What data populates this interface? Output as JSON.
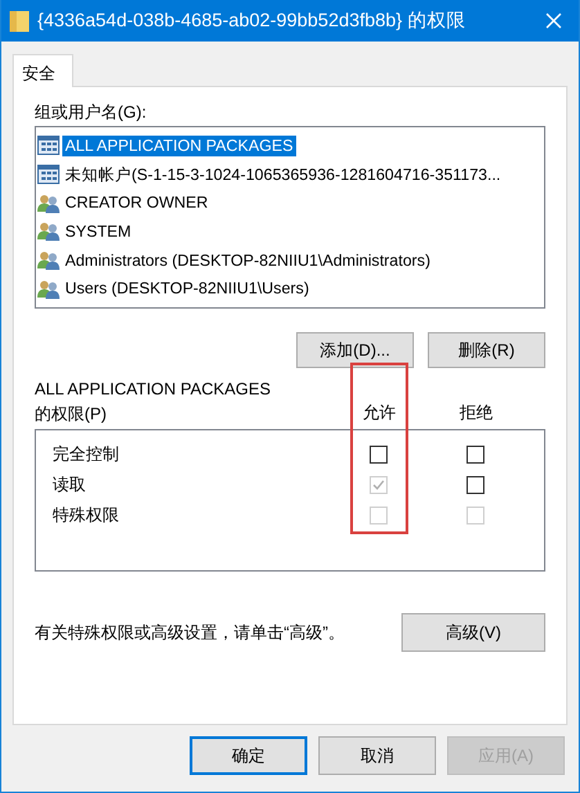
{
  "window": {
    "title": "{4336a54d-038b-4685-ab02-99bb52d3fb8b} 的权限"
  },
  "tabs": [
    {
      "label": "安全",
      "selected": true
    }
  ],
  "principals_label": "组或用户名(G):",
  "principals": [
    {
      "kind": "package",
      "name": "ALL APPLICATION PACKAGES",
      "selected": true
    },
    {
      "kind": "package",
      "name": "未知帐户(S-1-15-3-1024-1065365936-1281604716-351173...",
      "selected": false
    },
    {
      "kind": "group",
      "name": "CREATOR OWNER",
      "selected": false
    },
    {
      "kind": "group",
      "name": "SYSTEM",
      "selected": false
    },
    {
      "kind": "group",
      "name": "Administrators (DESKTOP-82NIIU1\\Administrators)",
      "selected": false
    },
    {
      "kind": "group",
      "name": "Users (DESKTOP-82NIIU1\\Users)",
      "selected": false
    }
  ],
  "principal_buttons": [
    "添加(D)...",
    "删除(R)"
  ],
  "permissions": {
    "title": "ALL APPLICATION PACKAGES\n的权限(P)",
    "columns": [
      {
        "label": "允许",
        "highlighted": true
      },
      {
        "label": "拒绝",
        "highlighted": false
      }
    ],
    "rows": [
      {
        "label": "完全控制",
        "cells": [
          {
            "checked": false,
            "disabled": false
          },
          {
            "checked": false,
            "disabled": false
          }
        ]
      },
      {
        "label": "读取",
        "cells": [
          {
            "checked": true,
            "disabled": true
          },
          {
            "checked": false,
            "disabled": false
          }
        ]
      },
      {
        "label": "特殊权限",
        "cells": [
          {
            "checked": false,
            "disabled": true
          },
          {
            "checked": false,
            "disabled": true
          }
        ]
      }
    ]
  },
  "advanced_hint": "有关特殊权限或高级设置，请单击“高级”。",
  "advanced_button": "高级(V)",
  "dialog_buttons": [
    {
      "label": "确定",
      "default": true,
      "disabled": false
    },
    {
      "label": "取消",
      "default": false,
      "disabled": false
    },
    {
      "label": "应用(A)",
      "default": false,
      "disabled": true
    }
  ]
}
